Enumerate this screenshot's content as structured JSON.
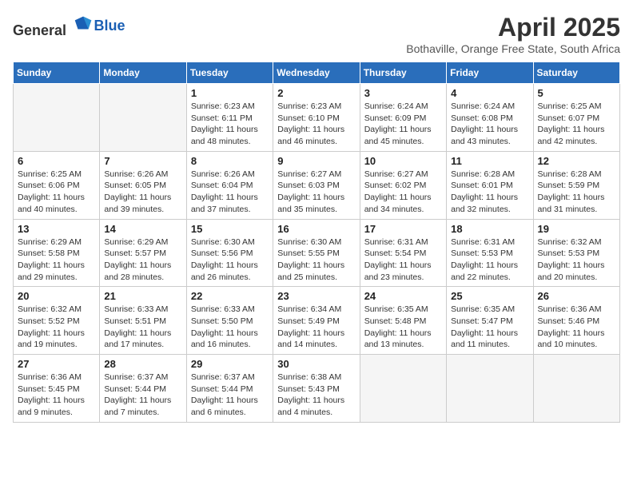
{
  "header": {
    "logo_general": "General",
    "logo_blue": "Blue",
    "month_title": "April 2025",
    "location": "Bothaville, Orange Free State, South Africa"
  },
  "weekdays": [
    "Sunday",
    "Monday",
    "Tuesday",
    "Wednesday",
    "Thursday",
    "Friday",
    "Saturday"
  ],
  "weeks": [
    [
      {
        "day": "",
        "info": ""
      },
      {
        "day": "",
        "info": ""
      },
      {
        "day": "1",
        "info": "Sunrise: 6:23 AM\nSunset: 6:11 PM\nDaylight: 11 hours and 48 minutes."
      },
      {
        "day": "2",
        "info": "Sunrise: 6:23 AM\nSunset: 6:10 PM\nDaylight: 11 hours and 46 minutes."
      },
      {
        "day": "3",
        "info": "Sunrise: 6:24 AM\nSunset: 6:09 PM\nDaylight: 11 hours and 45 minutes."
      },
      {
        "day": "4",
        "info": "Sunrise: 6:24 AM\nSunset: 6:08 PM\nDaylight: 11 hours and 43 minutes."
      },
      {
        "day": "5",
        "info": "Sunrise: 6:25 AM\nSunset: 6:07 PM\nDaylight: 11 hours and 42 minutes."
      }
    ],
    [
      {
        "day": "6",
        "info": "Sunrise: 6:25 AM\nSunset: 6:06 PM\nDaylight: 11 hours and 40 minutes."
      },
      {
        "day": "7",
        "info": "Sunrise: 6:26 AM\nSunset: 6:05 PM\nDaylight: 11 hours and 39 minutes."
      },
      {
        "day": "8",
        "info": "Sunrise: 6:26 AM\nSunset: 6:04 PM\nDaylight: 11 hours and 37 minutes."
      },
      {
        "day": "9",
        "info": "Sunrise: 6:27 AM\nSunset: 6:03 PM\nDaylight: 11 hours and 35 minutes."
      },
      {
        "day": "10",
        "info": "Sunrise: 6:27 AM\nSunset: 6:02 PM\nDaylight: 11 hours and 34 minutes."
      },
      {
        "day": "11",
        "info": "Sunrise: 6:28 AM\nSunset: 6:01 PM\nDaylight: 11 hours and 32 minutes."
      },
      {
        "day": "12",
        "info": "Sunrise: 6:28 AM\nSunset: 5:59 PM\nDaylight: 11 hours and 31 minutes."
      }
    ],
    [
      {
        "day": "13",
        "info": "Sunrise: 6:29 AM\nSunset: 5:58 PM\nDaylight: 11 hours and 29 minutes."
      },
      {
        "day": "14",
        "info": "Sunrise: 6:29 AM\nSunset: 5:57 PM\nDaylight: 11 hours and 28 minutes."
      },
      {
        "day": "15",
        "info": "Sunrise: 6:30 AM\nSunset: 5:56 PM\nDaylight: 11 hours and 26 minutes."
      },
      {
        "day": "16",
        "info": "Sunrise: 6:30 AM\nSunset: 5:55 PM\nDaylight: 11 hours and 25 minutes."
      },
      {
        "day": "17",
        "info": "Sunrise: 6:31 AM\nSunset: 5:54 PM\nDaylight: 11 hours and 23 minutes."
      },
      {
        "day": "18",
        "info": "Sunrise: 6:31 AM\nSunset: 5:53 PM\nDaylight: 11 hours and 22 minutes."
      },
      {
        "day": "19",
        "info": "Sunrise: 6:32 AM\nSunset: 5:53 PM\nDaylight: 11 hours and 20 minutes."
      }
    ],
    [
      {
        "day": "20",
        "info": "Sunrise: 6:32 AM\nSunset: 5:52 PM\nDaylight: 11 hours and 19 minutes."
      },
      {
        "day": "21",
        "info": "Sunrise: 6:33 AM\nSunset: 5:51 PM\nDaylight: 11 hours and 17 minutes."
      },
      {
        "day": "22",
        "info": "Sunrise: 6:33 AM\nSunset: 5:50 PM\nDaylight: 11 hours and 16 minutes."
      },
      {
        "day": "23",
        "info": "Sunrise: 6:34 AM\nSunset: 5:49 PM\nDaylight: 11 hours and 14 minutes."
      },
      {
        "day": "24",
        "info": "Sunrise: 6:35 AM\nSunset: 5:48 PM\nDaylight: 11 hours and 13 minutes."
      },
      {
        "day": "25",
        "info": "Sunrise: 6:35 AM\nSunset: 5:47 PM\nDaylight: 11 hours and 11 minutes."
      },
      {
        "day": "26",
        "info": "Sunrise: 6:36 AM\nSunset: 5:46 PM\nDaylight: 11 hours and 10 minutes."
      }
    ],
    [
      {
        "day": "27",
        "info": "Sunrise: 6:36 AM\nSunset: 5:45 PM\nDaylight: 11 hours and 9 minutes."
      },
      {
        "day": "28",
        "info": "Sunrise: 6:37 AM\nSunset: 5:44 PM\nDaylight: 11 hours and 7 minutes."
      },
      {
        "day": "29",
        "info": "Sunrise: 6:37 AM\nSunset: 5:44 PM\nDaylight: 11 hours and 6 minutes."
      },
      {
        "day": "30",
        "info": "Sunrise: 6:38 AM\nSunset: 5:43 PM\nDaylight: 11 hours and 4 minutes."
      },
      {
        "day": "",
        "info": ""
      },
      {
        "day": "",
        "info": ""
      },
      {
        "day": "",
        "info": ""
      }
    ]
  ]
}
